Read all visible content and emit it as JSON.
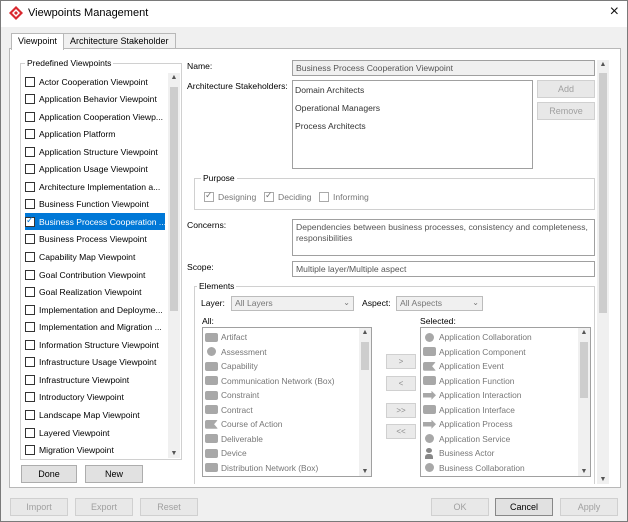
{
  "window": {
    "title": "Viewpoints Management",
    "close_icon": "×"
  },
  "tabs": [
    {
      "label": "Viewpoint"
    },
    {
      "label": "Architecture Stakeholder"
    }
  ],
  "predefined": {
    "title": "Predefined Viewpoints",
    "items": [
      {
        "label": "Actor Cooperation Viewpoint",
        "checked": false
      },
      {
        "label": "Application Behavior Viewpoint",
        "checked": false
      },
      {
        "label": "Application Cooperation Viewp...",
        "checked": false
      },
      {
        "label": "Application Platform",
        "checked": false
      },
      {
        "label": "Application Structure Viewpoint",
        "checked": false
      },
      {
        "label": "Application Usage Viewpoint",
        "checked": false
      },
      {
        "label": "Architecture Implementation a...",
        "checked": false
      },
      {
        "label": "Business Function Viewpoint",
        "checked": false
      },
      {
        "label": "Business Process Cooperation ...",
        "checked": true,
        "selected": true
      },
      {
        "label": "Business Process Viewpoint",
        "checked": false
      },
      {
        "label": "Capability Map Viewpoint",
        "checked": false
      },
      {
        "label": "Goal Contribution Viewpoint",
        "checked": false
      },
      {
        "label": "Goal Realization Viewpoint",
        "checked": false
      },
      {
        "label": "Implementation and Deployme...",
        "checked": false
      },
      {
        "label": "Implementation and Migration ...",
        "checked": false
      },
      {
        "label": "Information Structure Viewpoint",
        "checked": false
      },
      {
        "label": "Infrastructure Usage Viewpoint",
        "checked": false
      },
      {
        "label": "Infrastructure Viewpoint",
        "checked": false
      },
      {
        "label": "Introductory Viewpoint",
        "checked": false
      },
      {
        "label": "Landscape Map Viewpoint",
        "checked": false
      },
      {
        "label": "Layered Viewpoint",
        "checked": false
      },
      {
        "label": "Migration Viewpoint",
        "checked": false
      }
    ],
    "done_label": "Done",
    "new_label": "New"
  },
  "details": {
    "name_label": "Name:",
    "name_value": "Business Process Cooperation Viewpoint",
    "stakeholders_label": "Architecture Stakeholders:",
    "stakeholders": [
      "Domain Architects",
      "Operational Managers",
      "Process Architects"
    ],
    "add_label": "Add",
    "remove_label": "Remove",
    "purpose_title": "Purpose",
    "purpose": [
      {
        "label": "Designing",
        "checked": true
      },
      {
        "label": "Deciding",
        "checked": true
      },
      {
        "label": "Informing",
        "checked": false
      }
    ],
    "concerns_label": "Concerns:",
    "concerns_value": "Dependencies between business processes, consistency and completeness, responsibilities",
    "scope_label": "Scope:",
    "scope_value": "Multiple layer/Multiple aspect",
    "elements_title": "Elements",
    "layer_label": "Layer:",
    "layer_value": "All Layers",
    "aspect_label": "Aspect:",
    "aspect_value": "All Aspects",
    "all_label": "All:",
    "selected_label": "Selected:",
    "all_items": [
      {
        "label": "Artifact",
        "icon": "artifact-icon"
      },
      {
        "label": "Assessment",
        "icon": "assessment-icon"
      },
      {
        "label": "Capability",
        "icon": "capability-icon"
      },
      {
        "label": "Communication Network (Box)",
        "icon": "network-icon"
      },
      {
        "label": "Constraint",
        "icon": "constraint-icon"
      },
      {
        "label": "Contract",
        "icon": "contract-icon"
      },
      {
        "label": "Course of Action",
        "icon": "course-of-action-icon"
      },
      {
        "label": "Deliverable",
        "icon": "deliverable-icon"
      },
      {
        "label": "Device",
        "icon": "device-icon"
      },
      {
        "label": "Distribution Network (Box)",
        "icon": "distribution-network-icon"
      }
    ],
    "selected_items": [
      {
        "label": "Application Collaboration",
        "icon": "collaboration-icon"
      },
      {
        "label": "Application Component",
        "icon": "component-icon"
      },
      {
        "label": "Application Event",
        "icon": "event-icon"
      },
      {
        "label": "Application Function",
        "icon": "function-icon"
      },
      {
        "label": "Application Interaction",
        "icon": "interaction-icon"
      },
      {
        "label": "Application Interface",
        "icon": "interface-icon"
      },
      {
        "label": "Application Process",
        "icon": "process-icon"
      },
      {
        "label": "Application Service",
        "icon": "service-icon"
      },
      {
        "label": "Business Actor",
        "icon": "actor-icon"
      },
      {
        "label": "Business Collaboration",
        "icon": "collaboration-icon"
      }
    ],
    "move_buttons": [
      ">",
      "<",
      ">>",
      "<<"
    ]
  },
  "footer": {
    "import_label": "Import",
    "export_label": "Export",
    "reset_label": "Reset",
    "ok_label": "OK",
    "cancel_label": "Cancel",
    "apply_label": "Apply"
  }
}
